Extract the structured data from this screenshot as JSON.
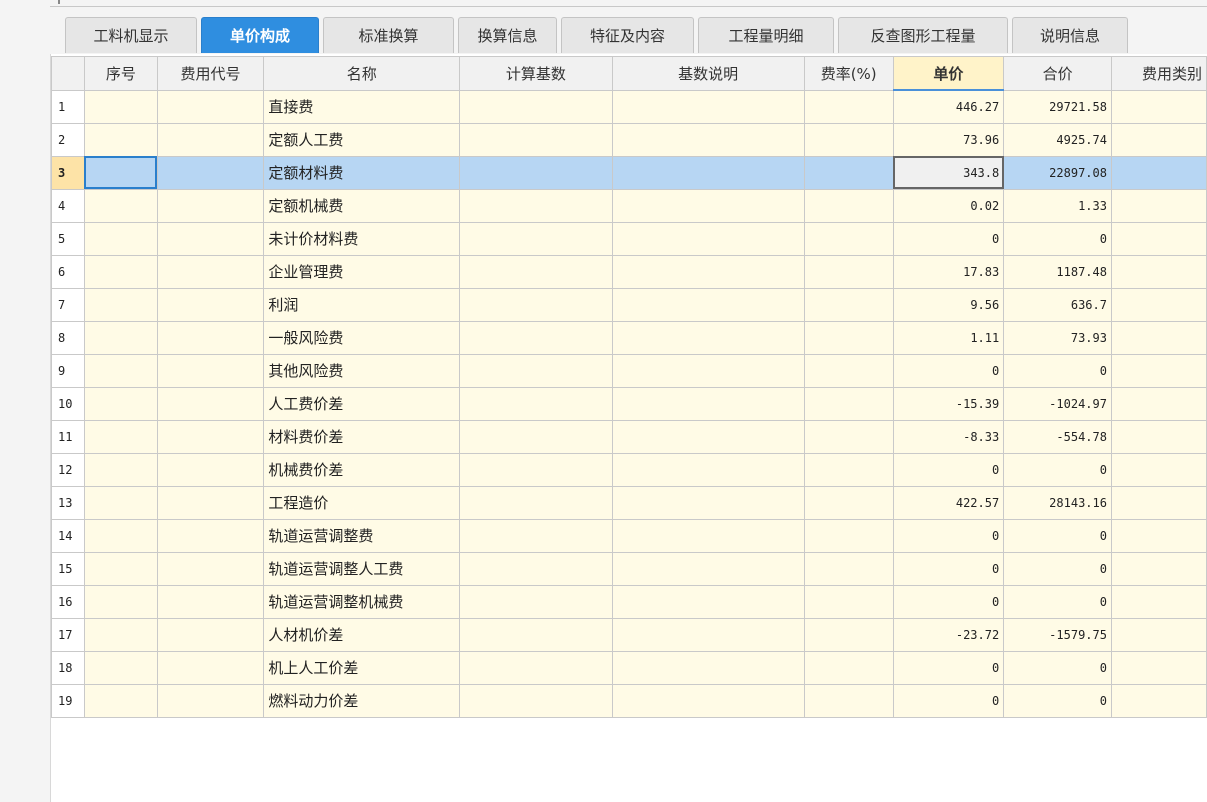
{
  "tabs": [
    {
      "label": "工料机显示",
      "active": false
    },
    {
      "label": "单价构成",
      "active": true
    },
    {
      "label": "标准换算",
      "active": false
    },
    {
      "label": "换算信息",
      "active": false
    },
    {
      "label": "特征及内容",
      "active": false
    },
    {
      "label": "工程量明细",
      "active": false
    },
    {
      "label": "反查图形工程量",
      "active": false
    },
    {
      "label": "说明信息",
      "active": false
    }
  ],
  "columns": [
    "",
    "序号",
    "费用代号",
    "名称",
    "计算基数",
    "基数说明",
    "费率(%)",
    "单价",
    "合价",
    "费用类别"
  ],
  "sorted_column": "单价",
  "selected_row": 3,
  "rows": [
    {
      "no": "1",
      "name": "直接费",
      "unit_price": "446.27",
      "total": "29721.58"
    },
    {
      "no": "2",
      "name": "定额人工费",
      "unit_price": "73.96",
      "total": "4925.74"
    },
    {
      "no": "3",
      "name": "定额材料费",
      "unit_price": "343.8",
      "total": "22897.08"
    },
    {
      "no": "4",
      "name": "定额机械费",
      "unit_price": "0.02",
      "total": "1.33"
    },
    {
      "no": "5",
      "name": "未计价材料费",
      "unit_price": "0",
      "total": "0"
    },
    {
      "no": "6",
      "name": "企业管理费",
      "unit_price": "17.83",
      "total": "1187.48"
    },
    {
      "no": "7",
      "name": "利润",
      "unit_price": "9.56",
      "total": "636.7"
    },
    {
      "no": "8",
      "name": "一般风险费",
      "unit_price": "1.11",
      "total": "73.93"
    },
    {
      "no": "9",
      "name": "其他风险费",
      "unit_price": "0",
      "total": "0"
    },
    {
      "no": "10",
      "name": "人工费价差",
      "unit_price": "-15.39",
      "total": "-1024.97"
    },
    {
      "no": "11",
      "name": "材料费价差",
      "unit_price": "-8.33",
      "total": "-554.78"
    },
    {
      "no": "12",
      "name": "机械费价差",
      "unit_price": "0",
      "total": "0"
    },
    {
      "no": "13",
      "name": "工程造价",
      "unit_price": "422.57",
      "total": "28143.16"
    },
    {
      "no": "14",
      "name": "轨道运营调整费",
      "unit_price": "0",
      "total": "0"
    },
    {
      "no": "15",
      "name": "轨道运营调整人工费",
      "unit_price": "0",
      "total": "0"
    },
    {
      "no": "16",
      "name": "轨道运营调整机械费",
      "unit_price": "0",
      "total": "0"
    },
    {
      "no": "17",
      "name": "人材机价差",
      "unit_price": "-23.72",
      "total": "-1579.75"
    },
    {
      "no": "18",
      "name": "机上人工价差",
      "unit_price": "0",
      "total": "0"
    },
    {
      "no": "19",
      "name": "燃料动力价差",
      "unit_price": "0",
      "total": "0"
    }
  ]
}
